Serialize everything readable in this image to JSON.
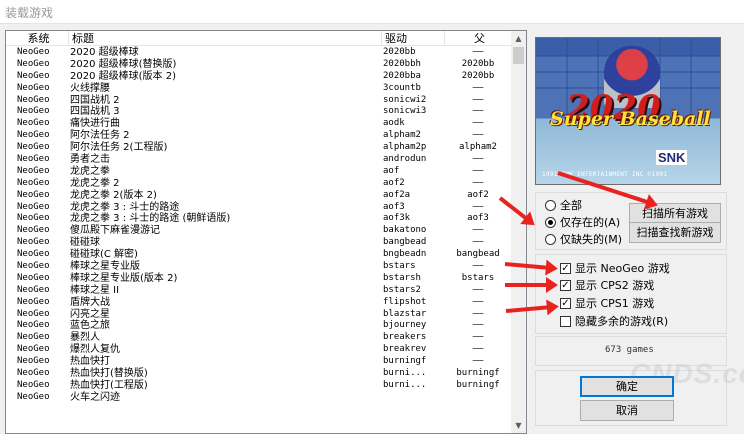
{
  "window": {
    "title": "装载游戏"
  },
  "list": {
    "headers": {
      "system": "系统",
      "title": "标题",
      "driver": "驱动",
      "parent": "父"
    },
    "rows": [
      {
        "system": "NeoGeo",
        "title": "2020 超级棒球",
        "driver": "2020bb",
        "parent": "——"
      },
      {
        "system": "NeoGeo",
        "title": "2020 超级棒球(替换版)",
        "driver": "2020bbh",
        "parent": "2020bb"
      },
      {
        "system": "NeoGeo",
        "title": "2020 超级棒球(版本 2)",
        "driver": "2020bba",
        "parent": "2020bb"
      },
      {
        "system": "NeoGeo",
        "title": "火线撑腰",
        "driver": "3countb",
        "parent": "——"
      },
      {
        "system": "NeoGeo",
        "title": "四国战机 2",
        "driver": "sonicwi2",
        "parent": "——"
      },
      {
        "system": "NeoGeo",
        "title": "四国战机 3",
        "driver": "sonicwi3",
        "parent": "——"
      },
      {
        "system": "NeoGeo",
        "title": "痛快进行曲",
        "driver": "aodk",
        "parent": "——"
      },
      {
        "system": "NeoGeo",
        "title": "阿尔法任务 2",
        "driver": "alpham2",
        "parent": "——"
      },
      {
        "system": "NeoGeo",
        "title": "阿尔法任务 2(工程版)",
        "driver": "alpham2p",
        "parent": "alpham2"
      },
      {
        "system": "NeoGeo",
        "title": "勇者之击",
        "driver": "androdun",
        "parent": "——"
      },
      {
        "system": "NeoGeo",
        "title": "龙虎之拳",
        "driver": "aof",
        "parent": "——"
      },
      {
        "system": "NeoGeo",
        "title": "龙虎之拳 2",
        "driver": "aof2",
        "parent": "——"
      },
      {
        "system": "NeoGeo",
        "title": "龙虎之拳 2(版本 2)",
        "driver": "aof2a",
        "parent": "aof2"
      },
      {
        "system": "NeoGeo",
        "title": "龙虎之拳 3 : 斗士的路途",
        "driver": "aof3",
        "parent": "——"
      },
      {
        "system": "NeoGeo",
        "title": "龙虎之拳 3 : 斗士的路途 (朝鲜语版)",
        "driver": "aof3k",
        "parent": "aof3"
      },
      {
        "system": "NeoGeo",
        "title": "傻瓜殿下麻雀漫游记",
        "driver": "bakatono",
        "parent": "——"
      },
      {
        "system": "NeoGeo",
        "title": "碰碰球",
        "driver": "bangbead",
        "parent": "——"
      },
      {
        "system": "NeoGeo",
        "title": "碰碰球(C 解密)",
        "driver": "bngbeadn",
        "parent": "bangbead"
      },
      {
        "system": "NeoGeo",
        "title": "棒球之星专业版",
        "driver": "bstars",
        "parent": "——"
      },
      {
        "system": "NeoGeo",
        "title": "棒球之星专业版(版本 2)",
        "driver": "bstarsh",
        "parent": "bstars"
      },
      {
        "system": "NeoGeo",
        "title": "棒球之星 II",
        "driver": "bstars2",
        "parent": "——"
      },
      {
        "system": "NeoGeo",
        "title": "盾牌大战",
        "driver": "flipshot",
        "parent": "——"
      },
      {
        "system": "NeoGeo",
        "title": "闪亮之星",
        "driver": "blazstar",
        "parent": "——"
      },
      {
        "system": "NeoGeo",
        "title": "蓝色之旅",
        "driver": "bjourney",
        "parent": "——"
      },
      {
        "system": "NeoGeo",
        "title": "暴烈人",
        "driver": "breakers",
        "parent": "——"
      },
      {
        "system": "NeoGeo",
        "title": "爆烈人复仇",
        "driver": "breakrev",
        "parent": "——"
      },
      {
        "system": "NeoGeo",
        "title": "热血快打",
        "driver": "burningf",
        "parent": "——"
      },
      {
        "system": "NeoGeo",
        "title": "热血快打(替换版)",
        "driver": "burni...",
        "parent": "burningf"
      },
      {
        "system": "NeoGeo",
        "title": "热血快打(工程版)",
        "driver": "burni...",
        "parent": "burningf"
      },
      {
        "system": "NeoGeo",
        "title": "火车之闪迹",
        "driver": "",
        "parent": ""
      }
    ]
  },
  "preview": {
    "number": "2020",
    "title": "Super Baseball",
    "brand": "SNK",
    "copyright": "1991 SNK ENTERTAINMENT INC ©1991"
  },
  "filter": {
    "all_label": "全部",
    "available_label": "仅存在的(A)",
    "missing_label": "仅缺失的(M)",
    "selected": "available",
    "scan_all_label": "扫描所有游戏",
    "scan_new_label": "扫描查找新游戏"
  },
  "options": {
    "neogeo_label": "显示 NeoGeo 游戏",
    "cps2_label": "显示 CPS2 游戏",
    "cps1_label": "显示 CPS1 游戏",
    "hide_label": "隐藏多余的游戏(R)",
    "neogeo_checked": true,
    "cps2_checked": true,
    "cps1_checked": true,
    "hide_checked": false
  },
  "status": {
    "count": "673 games"
  },
  "actions": {
    "ok_label": "确定",
    "cancel_label": "取消"
  },
  "watermark": "CNDS.com",
  "colors": {
    "arrow": "#e8231f",
    "accent": "#0078d7"
  }
}
